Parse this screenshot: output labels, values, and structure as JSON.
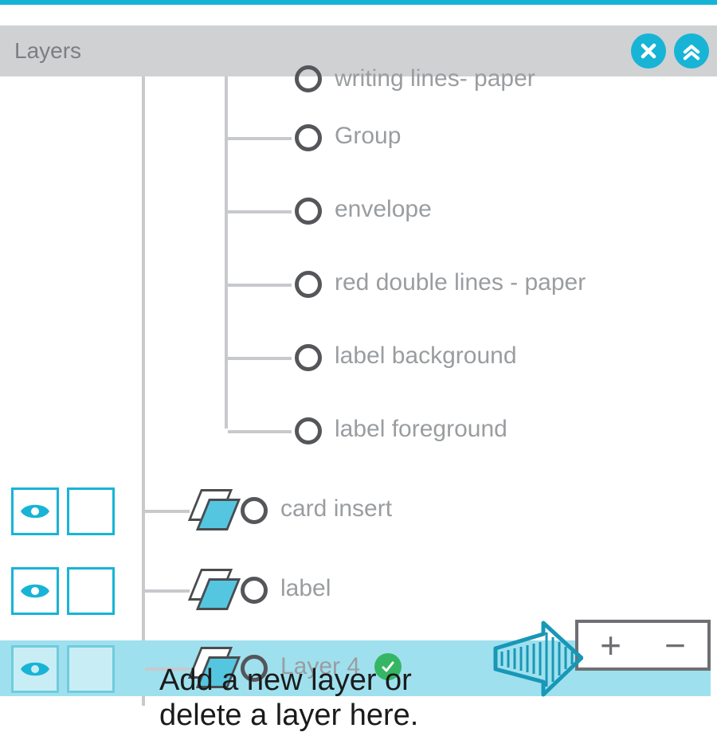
{
  "panel": {
    "title": "Layers"
  },
  "tree": {
    "sub_items": [
      {
        "label": "writing lines- paper"
      },
      {
        "label": "Group"
      },
      {
        "label": "envelope"
      },
      {
        "label": "red double lines - paper"
      },
      {
        "label": "label background"
      },
      {
        "label": "label foreground"
      }
    ],
    "layers": [
      {
        "label": "card insert",
        "selected": false
      },
      {
        "label": "label",
        "selected": false
      },
      {
        "label": "Layer 4",
        "selected": true,
        "checked": true
      }
    ]
  },
  "buttons": {
    "close": "X",
    "collapse": "collapse",
    "add": "+",
    "remove": "−"
  },
  "annotation": {
    "line1": "Add a new layer or",
    "line2": "delete a layer here."
  }
}
